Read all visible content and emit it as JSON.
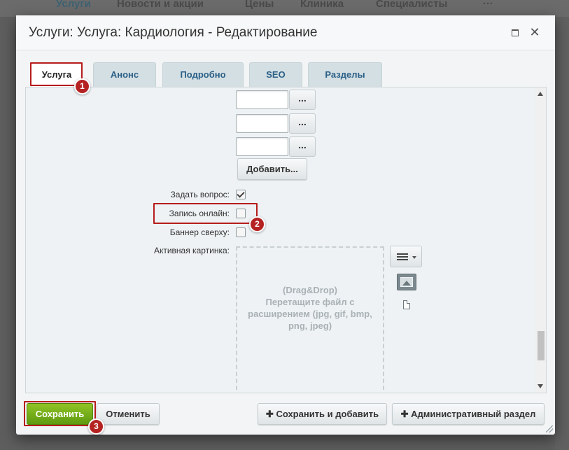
{
  "site_nav": {
    "items": [
      "Услуги",
      "Новости и акции",
      "Цены",
      "Клиника",
      "Специалисты"
    ],
    "more": "···"
  },
  "dialog": {
    "title": "Услуги: Услуга: Кардиология - Редактирование",
    "maximize_icon": "maximize-icon",
    "close_icon": "close-icon",
    "close_glyph": "✕"
  },
  "tabs": [
    {
      "label": "Услуга",
      "active": true
    },
    {
      "label": "Анонс",
      "active": false
    },
    {
      "label": "Подробно",
      "active": false
    },
    {
      "label": "SEO",
      "active": false
    },
    {
      "label": "Разделы",
      "active": false
    }
  ],
  "form": {
    "inputs": [
      "",
      "",
      ""
    ],
    "browse_label": "...",
    "add_label": "Добавить...",
    "fields": [
      {
        "label": "Задать вопрос:",
        "checked": true
      },
      {
        "label": "Запись онлайн:",
        "checked": false
      },
      {
        "label": "Баннер сверху:",
        "checked": false
      }
    ],
    "picture_label": "Активная картинка:",
    "dropzone_text": "(Drag&Drop)\nПеретащите файл с расширением (jpg, gif, bmp, png, jpeg)"
  },
  "annotations": [
    "1",
    "2",
    "3"
  ],
  "footer": {
    "save": "Сохранить",
    "cancel": "Отменить",
    "save_add": "Сохранить и добавить",
    "admin_section": "Административный раздел"
  },
  "colors": {
    "save_button": "#6fa818",
    "annotation": "#b52222",
    "tab_active_text": "#222222",
    "tab_text": "#2b6087"
  }
}
